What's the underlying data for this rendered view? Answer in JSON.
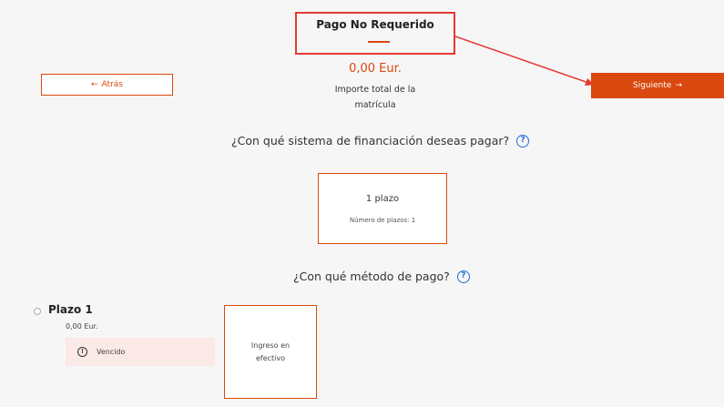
{
  "header": {
    "title": "Pago No Requerido",
    "amount": "0,00 Eur.",
    "amount_label_line1": "Importe total de la",
    "amount_label_line2": "matrícula"
  },
  "nav": {
    "back_label": "Atrás",
    "next_label": "Siguiente"
  },
  "financing": {
    "question": "¿Con qué sistema de financiación deseas pagar?",
    "option": {
      "title": "1 plazo",
      "subtitle": "Número de plazos: 1"
    }
  },
  "payment_method": {
    "question": "¿Con qué método de pago?",
    "options": [
      {
        "line1": "Ingreso en",
        "line2": "efectivo"
      }
    ]
  },
  "installments": [
    {
      "title": "Plazo 1",
      "amount": "0,00 Eur.",
      "status": "Vencido"
    }
  ],
  "colors": {
    "accent": "#d9480f",
    "highlight_box": "#e53935",
    "help_icon": "#1f6fd6",
    "status_bg": "#fbe9e7"
  }
}
